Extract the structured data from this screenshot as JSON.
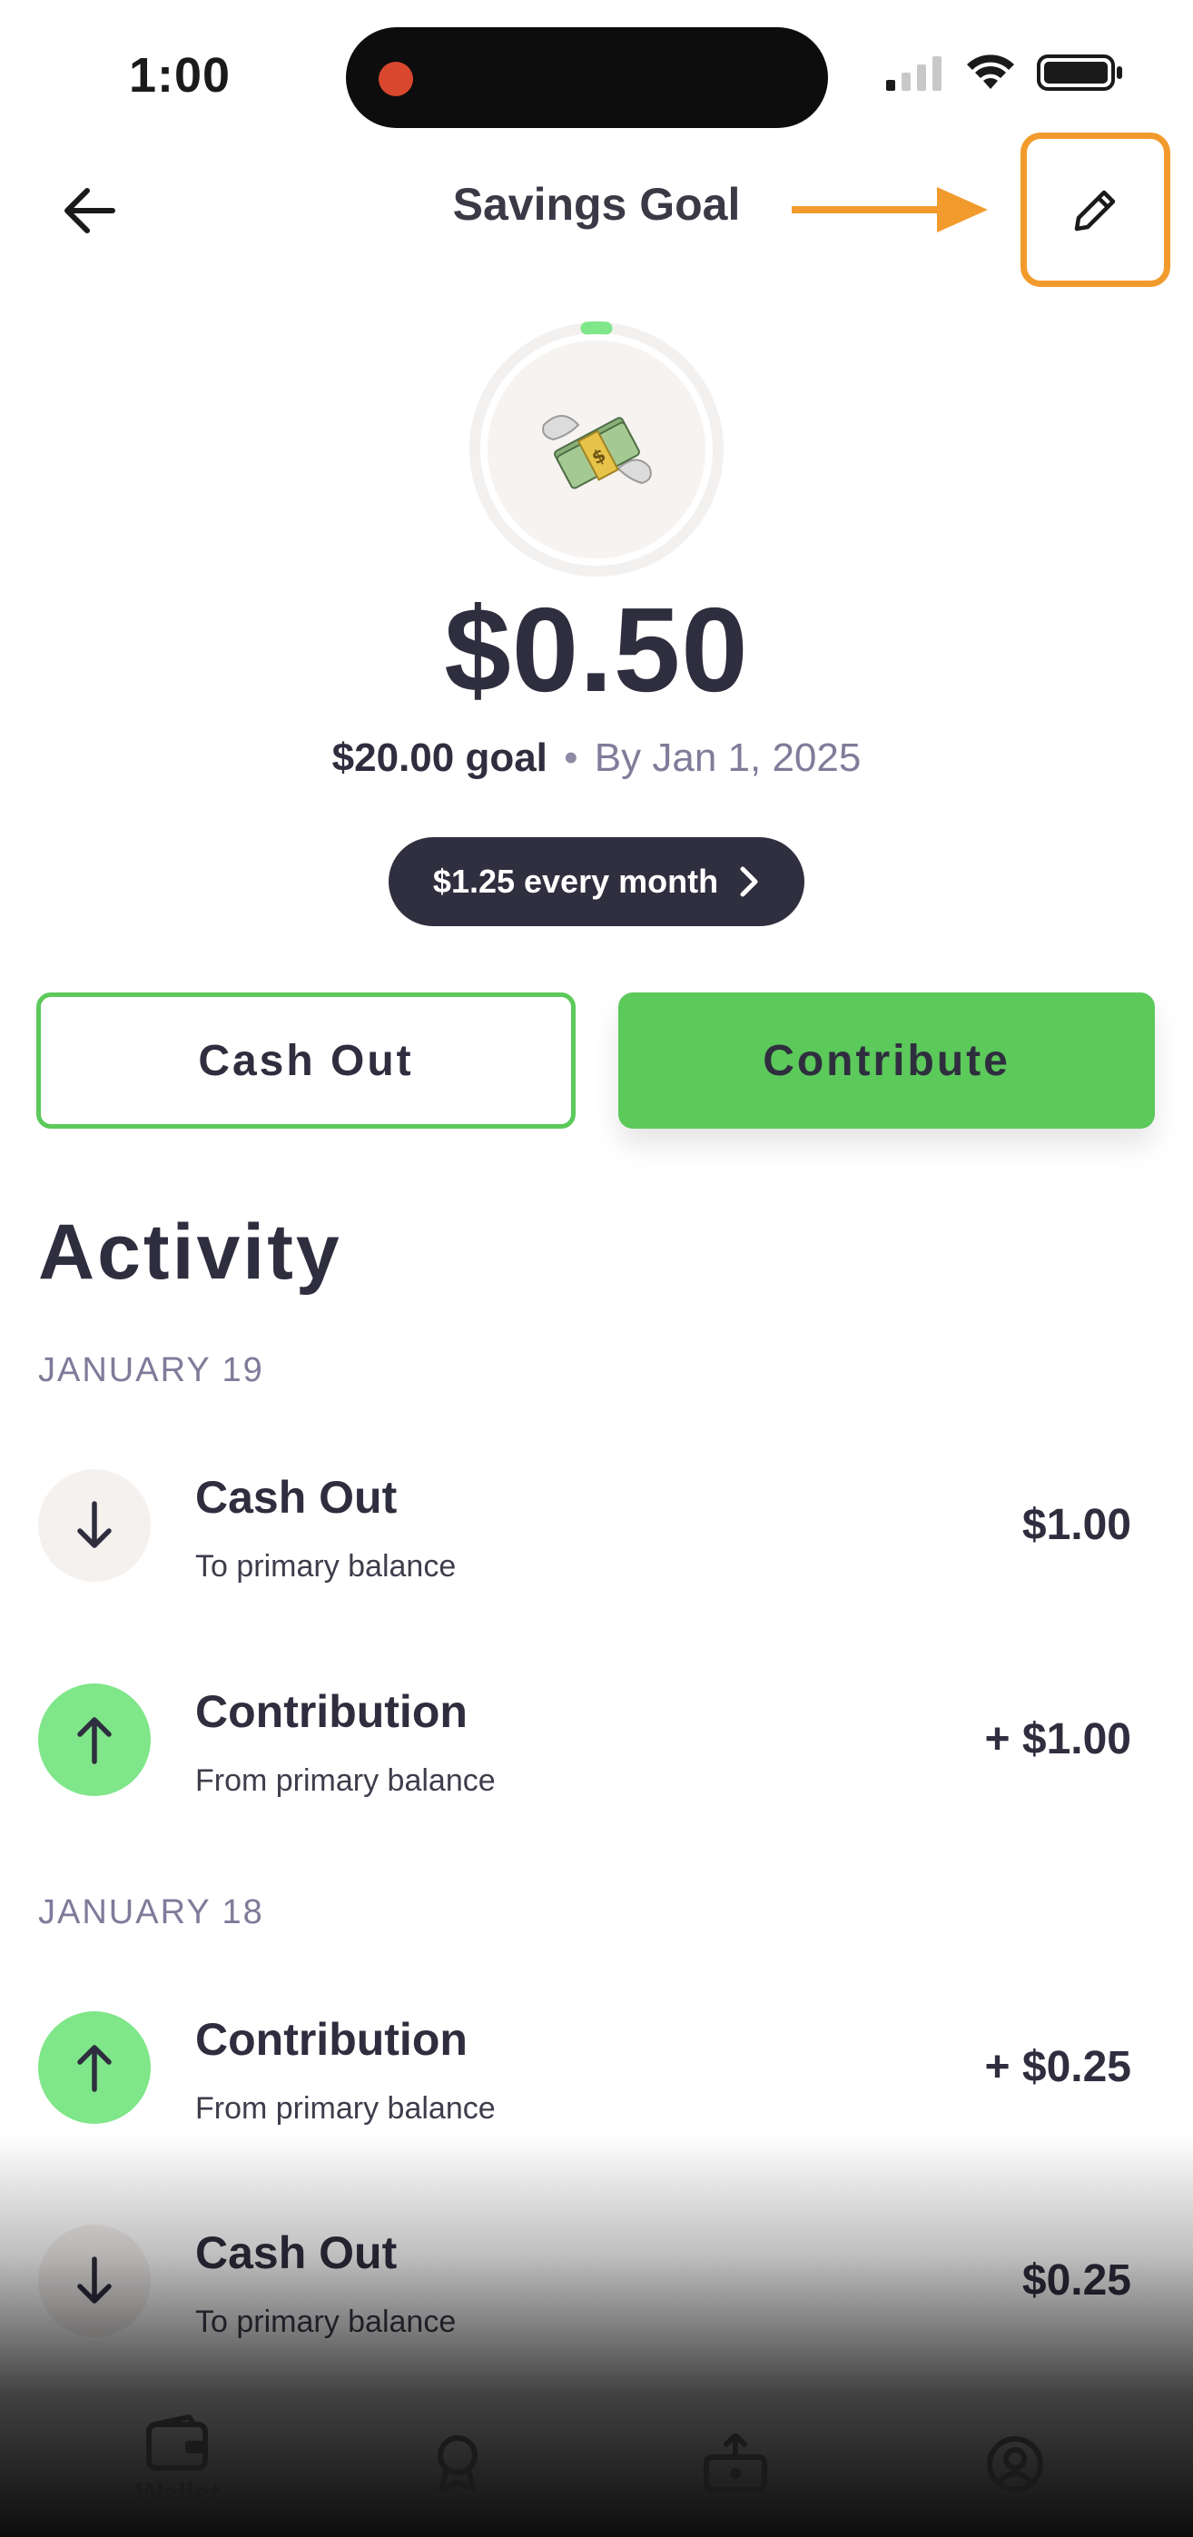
{
  "status_bar": {
    "time": "1:00"
  },
  "header": {
    "title": "Savings Goal",
    "annotation_color": "#f29b2d"
  },
  "goal": {
    "amount": "$0.50",
    "goal_amount": "$20.00 goal",
    "separator": "•",
    "target_date": "By Jan 1, 2025",
    "progress_fraction": 0.025,
    "schedule": "$1.25 every month"
  },
  "actions": {
    "cash_out_label": "Cash Out",
    "contribute_label": "Contribute"
  },
  "activity": {
    "title": "Activity",
    "groups": [
      {
        "date": "JANUARY 19",
        "items": [
          {
            "title": "Cash Out",
            "subtitle": "To primary balance",
            "amount": "$1.00",
            "direction": "out"
          },
          {
            "title": "Contribution",
            "subtitle": "From primary balance",
            "amount": "+ $1.00",
            "direction": "in"
          }
        ]
      },
      {
        "date": "JANUARY 18",
        "items": [
          {
            "title": "Contribution",
            "subtitle": "From primary balance",
            "amount": "+ $0.25",
            "direction": "in"
          },
          {
            "title": "Cash Out",
            "subtitle": "To primary balance",
            "amount": "$0.25",
            "direction": "out"
          }
        ]
      }
    ]
  },
  "bottom_nav": {
    "items": [
      {
        "label": "Wallet",
        "icon": "wallet-icon",
        "active": true
      },
      {
        "label": "",
        "icon": "badge-icon",
        "active": false
      },
      {
        "label": "",
        "icon": "send-money-icon",
        "active": false
      },
      {
        "label": "",
        "icon": "profile-icon",
        "active": false
      }
    ]
  },
  "colors": {
    "accent_green": "#5cc95b",
    "income_green": "#7fe689",
    "dark": "#2f2e3f",
    "muted": "#7e7b9a"
  }
}
